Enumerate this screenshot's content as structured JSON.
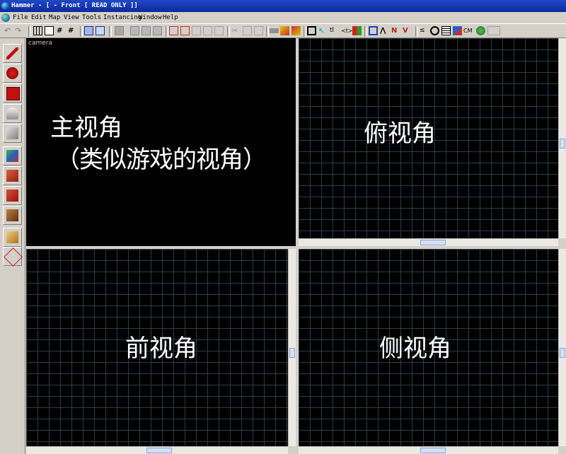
{
  "window": {
    "title": "Hammer - [ - Front [ READ ONLY ]]"
  },
  "menu": [
    {
      "label": "File"
    },
    {
      "label": "Edit"
    },
    {
      "label": "Map"
    },
    {
      "label": "View"
    },
    {
      "label": "Tools"
    },
    {
      "label": "Instancing"
    },
    {
      "label": "Window"
    },
    {
      "label": "Help"
    }
  ],
  "toolbar": {
    "cm_label": "CM"
  },
  "left_tools": [
    {
      "icon": "selection-pointer-icon"
    },
    {
      "icon": "magnify-icon"
    },
    {
      "icon": "camera-icon"
    },
    {
      "icon": "entity-icon"
    },
    {
      "icon": "block-icon"
    },
    {
      "icon": "texture-application-icon"
    },
    {
      "icon": "apply-decal-icon"
    },
    {
      "icon": "apply-overlay-icon"
    },
    {
      "icon": "clipping-icon"
    },
    {
      "icon": "vertex-manipulation-icon"
    },
    {
      "icon": "path-icon"
    }
  ],
  "viewports": {
    "camera": {
      "tag": "camera",
      "label_line1": "主视角",
      "label_line2": "（类似游戏的视角）"
    },
    "top": {
      "label": "俯视角"
    },
    "front": {
      "label": "前视角"
    },
    "side": {
      "label": "侧视角"
    }
  },
  "colors": {
    "titlebar": "#0a2a9a",
    "grid_line": "#2a3e46",
    "viewport_bg": "#000000",
    "chrome": "#d4d0c8"
  }
}
